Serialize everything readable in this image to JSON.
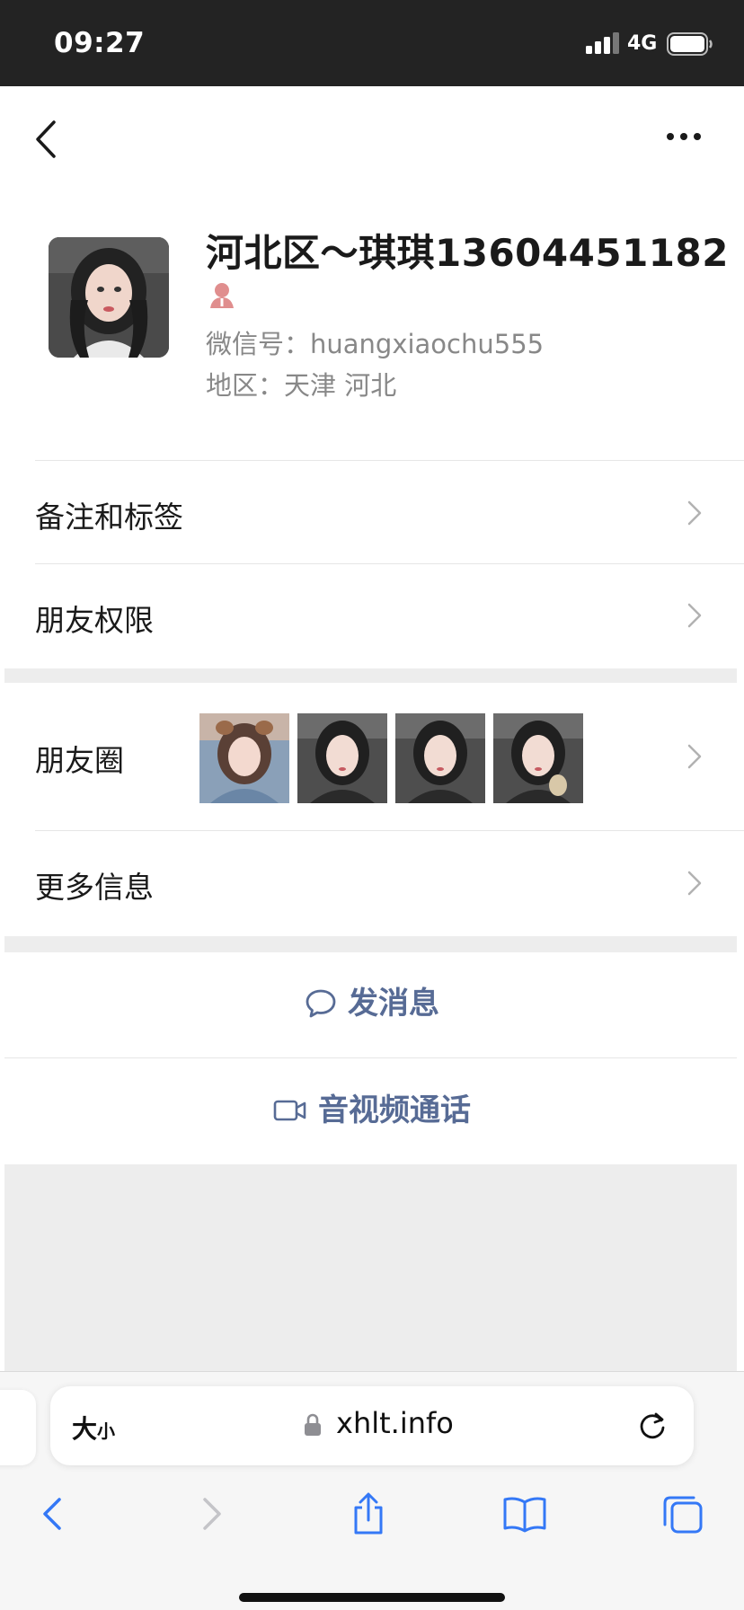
{
  "status_bar": {
    "time": "09:27",
    "network": "4G"
  },
  "profile": {
    "name": "河北区～琪琪13604451182",
    "gender_icon": "female-gender-icon",
    "gender_color": "#e08e8e",
    "wechat_id": "微信号：huangxiaochu555",
    "region": "地区：天津 河北"
  },
  "menu": {
    "remarks_tags": "备注和标签",
    "friend_permissions": "朋友权限",
    "moments": "朋友圈",
    "more_info": "更多信息"
  },
  "actions": {
    "send_message": "发消息",
    "av_call": "音视频通话",
    "accent_color": "#576b95"
  },
  "browser": {
    "text_size_big": "大",
    "text_size_small": "小",
    "url": "xhlt.info"
  },
  "icons": {
    "back": "chevron-left-icon",
    "more": "ellipsis-icon",
    "row_chevron": "chevron-right-icon",
    "message": "chat-bubble-icon",
    "video": "video-camera-icon",
    "lock": "lock-icon",
    "reload": "reload-icon",
    "share": "share-icon",
    "bookmarks": "book-icon",
    "tabs": "tabs-icon"
  },
  "colors": {
    "status_bar_bg": "#232323",
    "safari_blue": "#3478f6",
    "section_gap": "#ededed"
  }
}
